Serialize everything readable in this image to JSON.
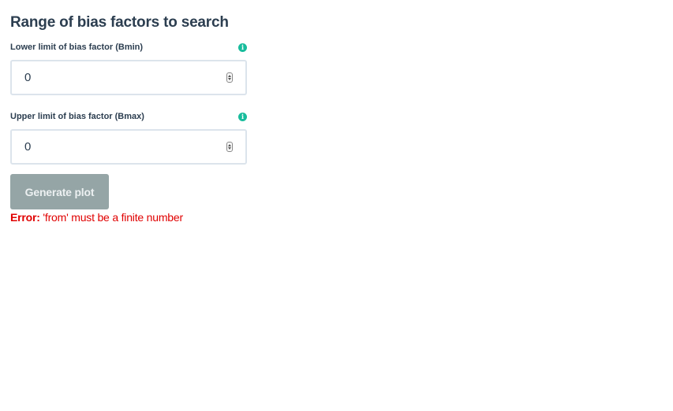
{
  "section": {
    "title": "Range of bias factors to search"
  },
  "fields": [
    {
      "label": "Lower limit of bias factor (Bmin)",
      "value": "0",
      "info_icon": "info-icon"
    },
    {
      "label": "Upper limit of bias factor (Bmax)",
      "value": "0",
      "info_icon": "info-icon"
    }
  ],
  "button": {
    "label": "Generate plot"
  },
  "error": {
    "label": "Error:",
    "message": "'from' must be a finite number"
  },
  "colors": {
    "text": "#2c3e50",
    "info_icon": "#18bc9c",
    "button_bg": "#95a5a6",
    "input_border": "#dce4ec",
    "error": "#e00000"
  }
}
